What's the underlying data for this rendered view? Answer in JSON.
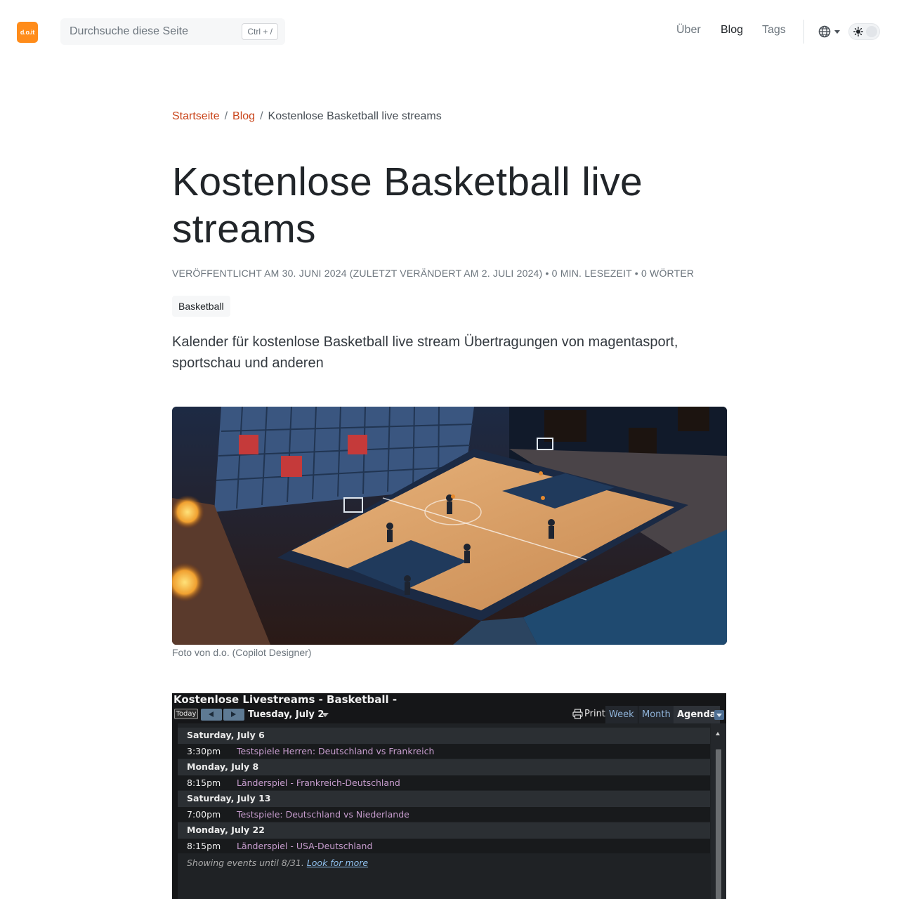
{
  "header": {
    "logo_text": "d.o.it",
    "search_placeholder": "Durchsuche diese Seite",
    "search_shortcut": "Ctrl + /",
    "nav": [
      {
        "label": "Über",
        "active": false
      },
      {
        "label": "Blog",
        "active": true
      },
      {
        "label": "Tags",
        "active": false
      }
    ],
    "language_icon": "globe-icon",
    "theme_icon": "sun-icon"
  },
  "breadcrumb": {
    "home": "Startseite",
    "blog": "Blog",
    "separator": "/",
    "current": "Kostenlose Basketball live streams"
  },
  "article": {
    "title": "Kostenlose Basketball live streams",
    "meta": "VERÖFFENTLICHT AM 30. JUNI 2024  (ZULETZT VERÄNDERT AM 2. JULI 2024) • 0 MIN. LESEZEIT • 0 WÖRTER",
    "tag": "Basketball",
    "lead": "Kalender für kostenlose Basketball live stream Übertragungen von magentasport, sportschau und anderen",
    "image_caption": "Foto von d.o. (Copilot Designer)"
  },
  "calendar": {
    "title": "Kostenlose Livestreams - Basketball -",
    "today_label": "Today",
    "current_date": "Tuesday, July 2",
    "print_label": "Print",
    "tabs": [
      {
        "label": "Week",
        "active": false
      },
      {
        "label": "Month",
        "active": false
      },
      {
        "label": "Agenda",
        "active": true
      }
    ],
    "days": [
      {
        "date": "Saturday, July 6",
        "events": [
          {
            "time": "3:30pm",
            "title": "Testspiele Herren: Deutschland vs Frankreich"
          }
        ]
      },
      {
        "date": "Monday, July 8",
        "events": [
          {
            "time": "8:15pm",
            "title": "Länderspiel - Frankreich-Deutschland"
          }
        ]
      },
      {
        "date": "Saturday, July 13",
        "events": [
          {
            "time": "7:00pm",
            "title": "Testspiele: Deutschland vs Niederlande"
          }
        ]
      },
      {
        "date": "Monday, July 22",
        "events": [
          {
            "time": "8:15pm",
            "title": "Länderspiel - USA-Deutschland"
          }
        ]
      }
    ],
    "footer_text": "Showing events until 8/31.",
    "footer_link": "Look for more"
  },
  "colors": {
    "brand_orange": "#ff8c1a",
    "link_red": "#c9451b",
    "calendar_bg": "#151618",
    "event_title": "#c79dce"
  }
}
